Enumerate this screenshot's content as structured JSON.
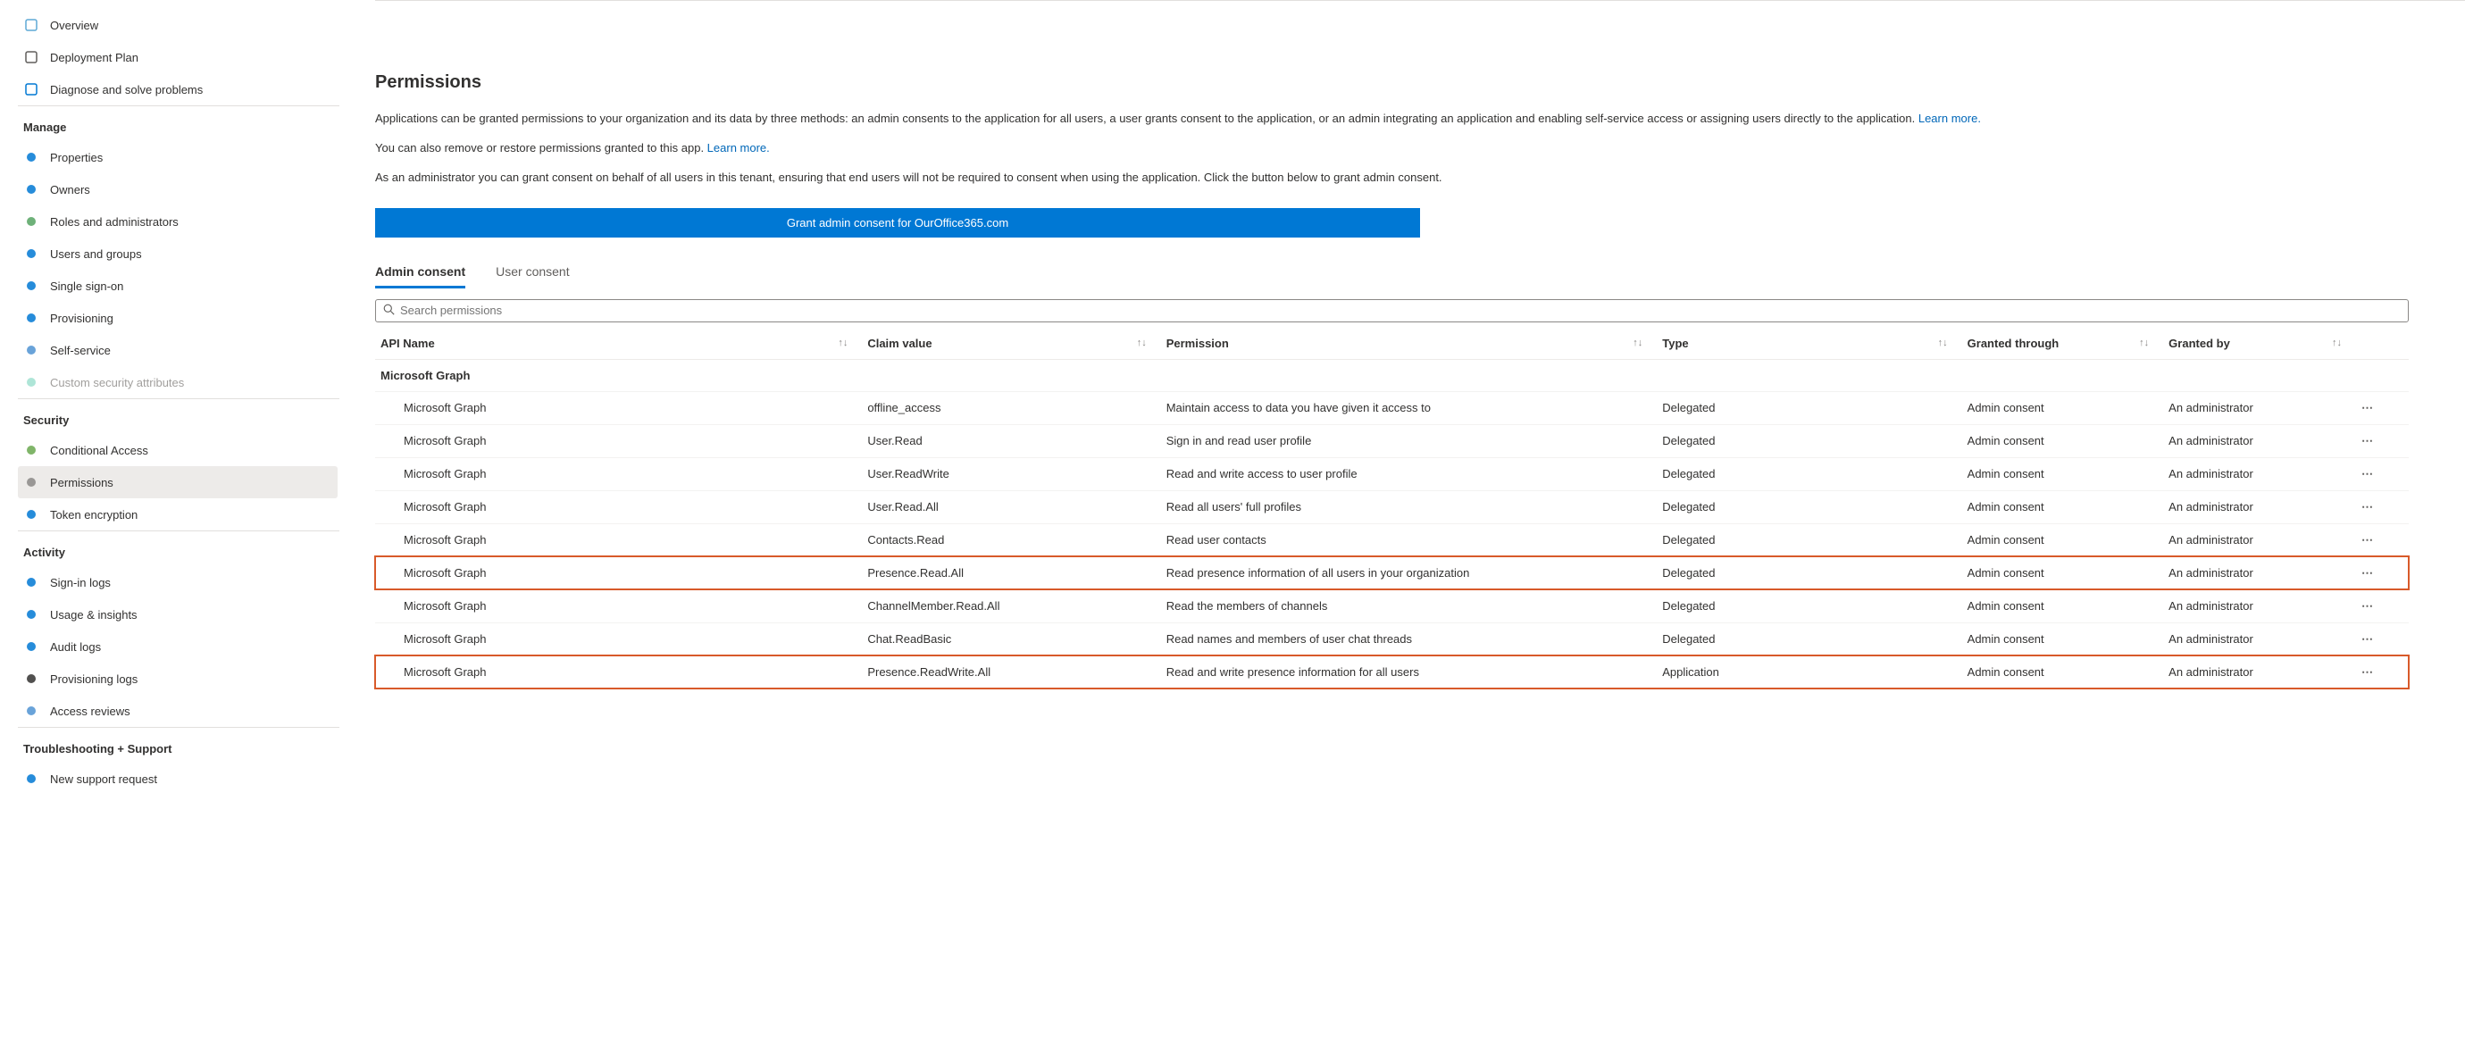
{
  "sidebar": {
    "top_items": [
      {
        "label": "Overview",
        "icon_color": "#5ea9d6"
      },
      {
        "label": "Deployment Plan",
        "icon_color": "#605e5c"
      },
      {
        "label": "Diagnose and solve problems",
        "icon_color": "#0078d4"
      }
    ],
    "groups": [
      {
        "label": "Manage",
        "items": [
          {
            "label": "Properties",
            "icon_color": "#0078d4"
          },
          {
            "label": "Owners",
            "icon_color": "#0078d4"
          },
          {
            "label": "Roles and administrators",
            "icon_color": "#55a362"
          },
          {
            "label": "Users and groups",
            "icon_color": "#0078d4"
          },
          {
            "label": "Single sign-on",
            "icon_color": "#0078d4"
          },
          {
            "label": "Provisioning",
            "icon_color": "#0078d4"
          },
          {
            "label": "Self-service",
            "icon_color": "#4f93d2"
          },
          {
            "label": "Custom security attributes",
            "icon_color": "#a0e0d0",
            "disabled": true
          }
        ]
      },
      {
        "label": "Security",
        "items": [
          {
            "label": "Conditional Access",
            "icon_color": "#6aa84f"
          },
          {
            "label": "Permissions",
            "icon_color": "#8a8886",
            "active": true
          },
          {
            "label": "Token encryption",
            "icon_color": "#0078d4"
          }
        ]
      },
      {
        "label": "Activity",
        "items": [
          {
            "label": "Sign-in logs",
            "icon_color": "#0078d4"
          },
          {
            "label": "Usage & insights",
            "icon_color": "#0078d4"
          },
          {
            "label": "Audit logs",
            "icon_color": "#0078d4"
          },
          {
            "label": "Provisioning logs",
            "icon_color": "#323130"
          },
          {
            "label": "Access reviews",
            "icon_color": "#4f93d2"
          }
        ]
      },
      {
        "label": "Troubleshooting + Support",
        "items": [
          {
            "label": "New support request",
            "icon_color": "#0078d4"
          }
        ]
      }
    ]
  },
  "main": {
    "title": "Permissions",
    "desc1_a": "Applications can be granted permissions to your organization and its data by three methods: an admin consents to the application for all users, a user grants consent to the application, or an admin integrating an application and enabling self-service access or assigning users directly to the application. ",
    "learn_more": "Learn more.",
    "desc2_a": "You can also remove or restore permissions granted to this app. ",
    "desc3": "As an administrator you can grant consent on behalf of all users in this tenant, ensuring that end users will not be required to consent when using the application. Click the button below to grant admin consent.",
    "consent_btn": "Grant admin consent for OurOffice365.com",
    "tabs": [
      {
        "label": "Admin consent",
        "active": true
      },
      {
        "label": "User consent"
      }
    ],
    "search_placeholder": "Search permissions",
    "columns": [
      "API Name",
      "Claim value",
      "Permission",
      "Type",
      "Granted through",
      "Granted by"
    ],
    "group_header": "Microsoft Graph",
    "rows": [
      {
        "api": "Microsoft Graph",
        "claim": "offline_access",
        "perm": "Maintain access to data you have given it access to",
        "type": "Delegated",
        "granted": "Admin consent",
        "by": "An administrator"
      },
      {
        "api": "Microsoft Graph",
        "claim": "User.Read",
        "perm": "Sign in and read user profile",
        "type": "Delegated",
        "granted": "Admin consent",
        "by": "An administrator"
      },
      {
        "api": "Microsoft Graph",
        "claim": "User.ReadWrite",
        "perm": "Read and write access to user profile",
        "type": "Delegated",
        "granted": "Admin consent",
        "by": "An administrator"
      },
      {
        "api": "Microsoft Graph",
        "claim": "User.Read.All",
        "perm": "Read all users' full profiles",
        "type": "Delegated",
        "granted": "Admin consent",
        "by": "An administrator"
      },
      {
        "api": "Microsoft Graph",
        "claim": "Contacts.Read",
        "perm": "Read user contacts",
        "type": "Delegated",
        "granted": "Admin consent",
        "by": "An administrator"
      },
      {
        "api": "Microsoft Graph",
        "claim": "Presence.Read.All",
        "perm": "Read presence information of all users in your organization",
        "type": "Delegated",
        "granted": "Admin consent",
        "by": "An administrator",
        "highlight": true
      },
      {
        "api": "Microsoft Graph",
        "claim": "ChannelMember.Read.All",
        "perm": "Read the members of channels",
        "type": "Delegated",
        "granted": "Admin consent",
        "by": "An administrator"
      },
      {
        "api": "Microsoft Graph",
        "claim": "Chat.ReadBasic",
        "perm": "Read names and members of user chat threads",
        "type": "Delegated",
        "granted": "Admin consent",
        "by": "An administrator"
      },
      {
        "api": "Microsoft Graph",
        "claim": "Presence.ReadWrite.All",
        "perm": "Read and write presence information for all users",
        "type": "Application",
        "granted": "Admin consent",
        "by": "An administrator",
        "highlight": true
      }
    ]
  }
}
